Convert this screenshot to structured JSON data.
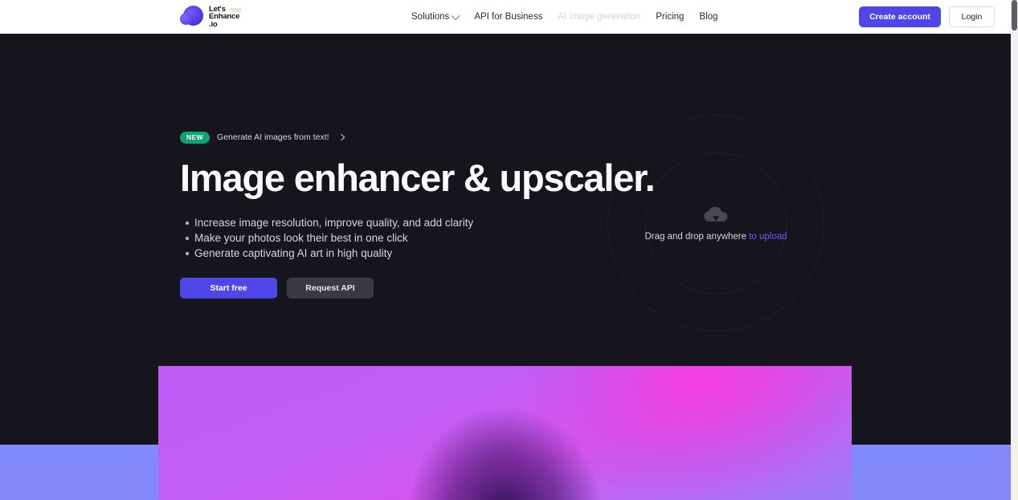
{
  "brand": {
    "line1": "Let's",
    "line2": "Enhance",
    "line3": ".io",
    "logo_icon": "lets-enhance-blob-logo"
  },
  "nav": {
    "items": [
      {
        "label": "Solutions",
        "has_dropdown": true,
        "muted": false
      },
      {
        "label": "API for Business",
        "has_dropdown": false,
        "muted": false
      },
      {
        "label": "AI image generation",
        "has_dropdown": false,
        "muted": true
      },
      {
        "label": "Pricing",
        "has_dropdown": false,
        "muted": false
      },
      {
        "label": "Blog",
        "has_dropdown": false,
        "muted": false
      }
    ]
  },
  "header_actions": {
    "create_account": "Create account",
    "login": "Login"
  },
  "hero": {
    "badge": "NEW",
    "announcement": "Generate AI images from text!",
    "title": "Image enhancer & upscaler.",
    "bullets": [
      "Increase image resolution, improve quality, and add clarity",
      "Make your photos look their best in one click",
      "Generate captivating AI art in high quality"
    ],
    "cta_primary": "Start free",
    "cta_secondary": "Request API"
  },
  "dropzone": {
    "icon": "cloud-upload-icon",
    "text": "Drag and drop anywhere ",
    "link": "to upload"
  },
  "colors": {
    "accent_indigo": "#4f46e8",
    "badge_green": "#0ea371",
    "hero_background": "#16151e",
    "header_background": "#ffffff",
    "band_periwinkle": "#8289fb",
    "upload_link": "#6a5ff0"
  }
}
